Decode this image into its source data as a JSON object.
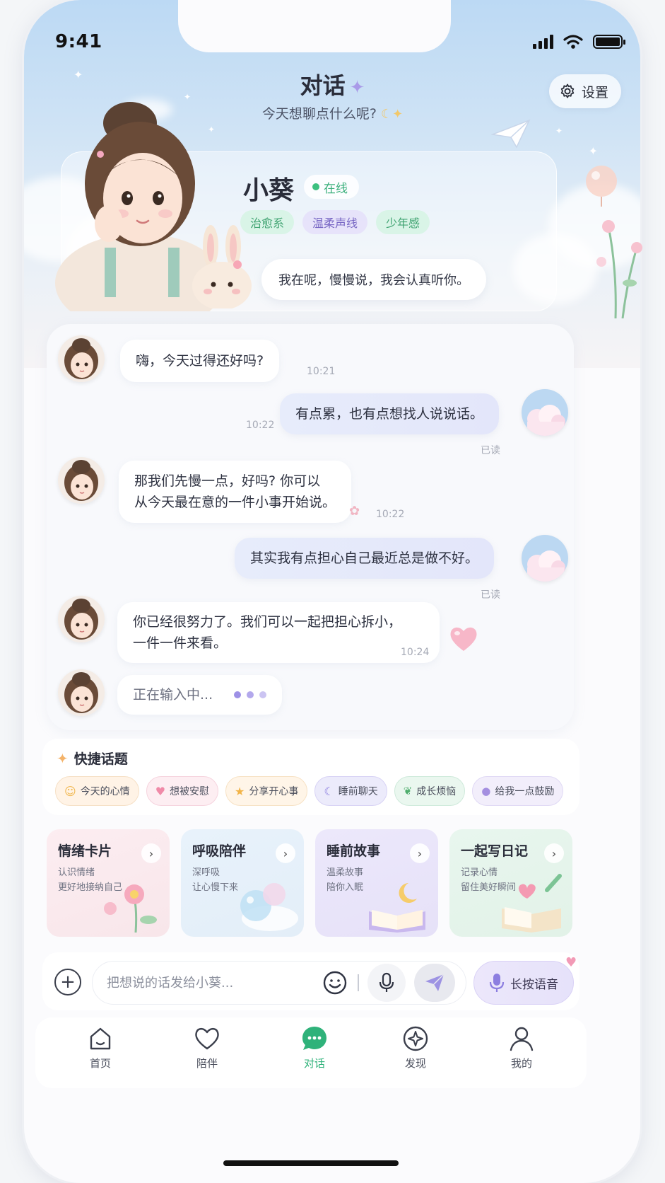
{
  "status": {
    "time": "9:41"
  },
  "header": {
    "title": "对话",
    "subtitle": "今天想聊点什么呢?",
    "settings_label": "设置"
  },
  "profile": {
    "name": "小葵",
    "status": "在线",
    "tags": [
      "治愈系",
      "温柔声线",
      "少年感"
    ],
    "greeting": "我在呢，慢慢说，我会认真听你。"
  },
  "chat": {
    "messages": [
      {
        "from": "bot",
        "text": "嗨，今天过得还好吗?",
        "time": "10:21"
      },
      {
        "from": "user",
        "text": "有点累，也有点想找人说说话。",
        "time": "10:22",
        "read": "已读"
      },
      {
        "from": "bot",
        "text_line1": "那我们先慢一点，好吗? 你可以",
        "text_line2": "从今天最在意的一件小事开始说。",
        "time": "10:22"
      },
      {
        "from": "user",
        "text": "其实我有点担心自己最近总是做不好。",
        "read": "已读"
      },
      {
        "from": "bot",
        "text_line1": "你已经很努力了。我们可以一起把担心拆小，",
        "text_line2": "一件一件来看。",
        "time": "10:24"
      }
    ],
    "typing": "正在输入中..."
  },
  "quick_topics": {
    "title": "快捷话题",
    "chips": [
      "今天的心情",
      "想被安慰",
      "分享开心事",
      "睡前聊天",
      "成长烦恼",
      "给我一点鼓励"
    ]
  },
  "features": [
    {
      "title": "情绪卡片",
      "line1": "认识情绪",
      "line2": "更好地接纳自己"
    },
    {
      "title": "呼吸陪伴",
      "line1": "深呼吸",
      "line2": "让心慢下来"
    },
    {
      "title": "睡前故事",
      "line1": "温柔故事",
      "line2": "陪你入眠"
    },
    {
      "title": "一起写日记",
      "line1": "记录心情",
      "line2": "留住美好瞬间"
    }
  ],
  "input": {
    "placeholder": "把想说的话发给小葵...",
    "voice_label": "长按语音"
  },
  "tabs": [
    "首页",
    "陪伴",
    "对话",
    "发现",
    "我的"
  ],
  "colors": {
    "accent_green": "#2fb27a",
    "accent_purple": "#8c7ee0",
    "bubble_user": "#e5e9fb"
  }
}
